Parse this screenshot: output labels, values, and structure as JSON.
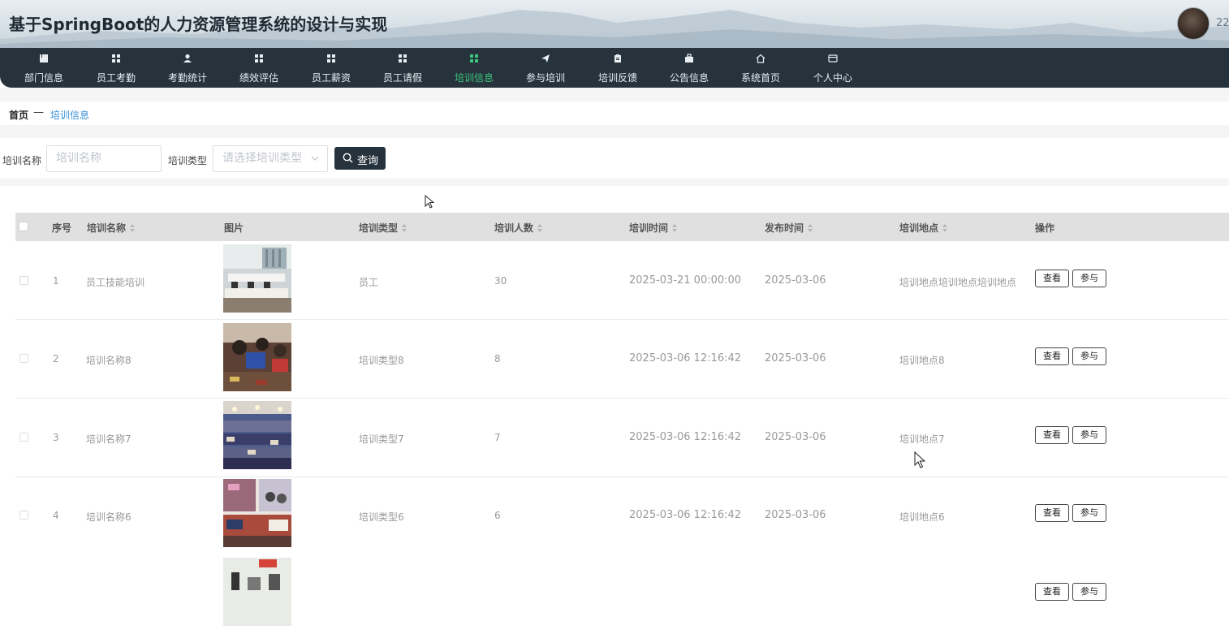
{
  "header": {
    "title": "基于SpringBoot的人力资源管理系统的设计与实现",
    "user_number": "22"
  },
  "nav": {
    "items": [
      {
        "label": "部门信息",
        "icon": "book-icon"
      },
      {
        "label": "员工考勤",
        "icon": "grid-icon"
      },
      {
        "label": "考勤统计",
        "icon": "user-icon"
      },
      {
        "label": "绩效评估",
        "icon": "grid-icon"
      },
      {
        "label": "员工薪资",
        "icon": "grid-icon"
      },
      {
        "label": "员工请假",
        "icon": "grid-icon"
      },
      {
        "label": "培训信息",
        "icon": "grid-icon",
        "active": true
      },
      {
        "label": "参与培训",
        "icon": "send-icon"
      },
      {
        "label": "培训反馈",
        "icon": "clipboard-icon"
      },
      {
        "label": "公告信息",
        "icon": "briefcase-icon"
      },
      {
        "label": "系统首页",
        "icon": "home-icon"
      },
      {
        "label": "个人中心",
        "icon": "card-icon"
      }
    ]
  },
  "breadcrumb": {
    "home": "首页",
    "separator": "—",
    "current": "培训信息"
  },
  "search": {
    "name_label": "培训名称",
    "name_placeholder": "培训名称",
    "type_label": "培训类型",
    "type_placeholder": "请选择培训类型",
    "button_label": "查询"
  },
  "table": {
    "headers": [
      "序号",
      "培训名称",
      "图片",
      "培训类型",
      "培训人数",
      "培训时间",
      "发布时间",
      "培训地点",
      "操作"
    ],
    "view_label": "查看",
    "join_label": "参与",
    "rows": [
      {
        "index": "1",
        "name": "员工技能培训",
        "type": "员工",
        "count": "30",
        "train_time": "2025-03-21 00:00:00",
        "publish_time": "2025-03-06",
        "location": "培训地点培训地点培训地点"
      },
      {
        "index": "2",
        "name": "培训名称8",
        "type": "培训类型8",
        "count": "8",
        "train_time": "2025-03-06 12:16:42",
        "publish_time": "2025-03-06",
        "location": "培训地点8"
      },
      {
        "index": "3",
        "name": "培训名称7",
        "type": "培训类型7",
        "count": "7",
        "train_time": "2025-03-06 12:16:42",
        "publish_time": "2025-03-06",
        "location": "培训地点7"
      },
      {
        "index": "4",
        "name": "培训名称6",
        "type": "培训类型6",
        "count": "6",
        "train_time": "2025-03-06 12:16:42",
        "publish_time": "2025-03-06",
        "location": "培训地点6"
      },
      {
        "index": "",
        "name": "",
        "type": "",
        "count": "",
        "train_time": "",
        "publish_time": "",
        "location": ""
      }
    ]
  },
  "colors": {
    "nav_bg": "#26333d",
    "active": "#3cc47c",
    "link": "#3a8fd6"
  }
}
